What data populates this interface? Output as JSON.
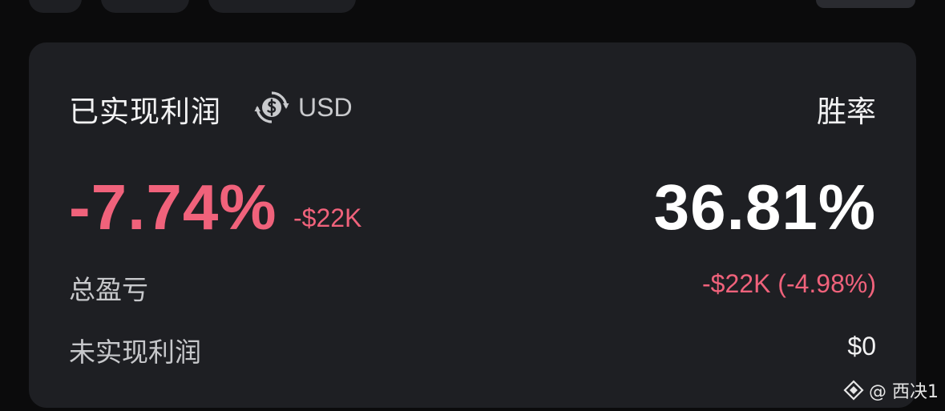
{
  "card": {
    "title": "已实现利润",
    "currency": {
      "label": "USD",
      "icon": "currency-swap-icon"
    },
    "winrate_title": "胜率",
    "pnl_percent": "-7.74%",
    "pnl_amount": "-$22K",
    "winrate_value": "36.81%",
    "rows": [
      {
        "label": "总盈亏",
        "value": "-$22K (-4.98%)"
      },
      {
        "label": "未实现利润",
        "value": "$0"
      }
    ]
  },
  "colors": {
    "background": "#0b0b0c",
    "card": "#1e1f23",
    "negative": "#f0627b",
    "text_primary": "#ffffff",
    "text_secondary": "#c7c8cb"
  },
  "watermark": {
    "icon": "binance-square-logo",
    "text": "@ 西决1"
  }
}
